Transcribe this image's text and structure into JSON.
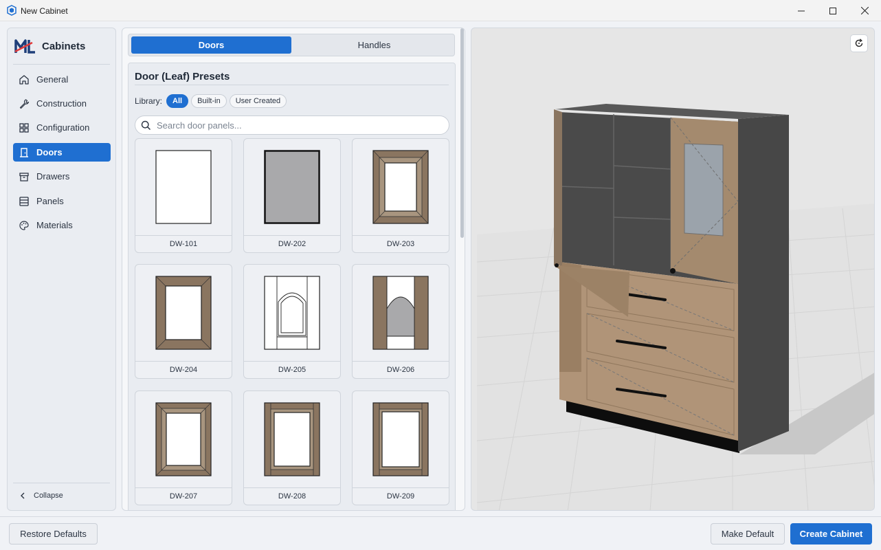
{
  "window": {
    "title": "New Cabinet"
  },
  "sidebar": {
    "brand": "Cabinets",
    "items": [
      {
        "label": "General",
        "icon": "home-icon",
        "active": false
      },
      {
        "label": "Construction",
        "icon": "wrench-icon",
        "active": false
      },
      {
        "label": "Configuration",
        "icon": "grid-icon",
        "active": false
      },
      {
        "label": "Doors",
        "icon": "door-icon",
        "active": true
      },
      {
        "label": "Drawers",
        "icon": "drawer-icon",
        "active": false
      },
      {
        "label": "Panels",
        "icon": "panels-icon",
        "active": false
      },
      {
        "label": "Materials",
        "icon": "palette-icon",
        "active": false
      }
    ],
    "collapse_label": "Collapse"
  },
  "tabs": [
    {
      "label": "Doors",
      "active": true
    },
    {
      "label": "Handles",
      "active": false
    }
  ],
  "presets": {
    "title": "Door (Leaf) Presets",
    "library_label": "Library:",
    "filters": [
      {
        "label": "All",
        "active": true
      },
      {
        "label": "Built-in",
        "active": false
      },
      {
        "label": "User Created",
        "active": false
      }
    ],
    "search_placeholder": "Search door panels...",
    "items": [
      {
        "code": "DW-101",
        "style": "flat-white"
      },
      {
        "code": "DW-202",
        "style": "flat-gray"
      },
      {
        "code": "DW-203",
        "style": "frame-wood-narrow"
      },
      {
        "code": "DW-204",
        "style": "frame-wood-wide"
      },
      {
        "code": "DW-205",
        "style": "arch-white"
      },
      {
        "code": "DW-206",
        "style": "arch-wood"
      },
      {
        "code": "DW-207",
        "style": "frame-wood-wide"
      },
      {
        "code": "DW-208",
        "style": "shaker-wood"
      },
      {
        "code": "DW-209",
        "style": "shaker-wood"
      }
    ]
  },
  "colors": {
    "accent": "#1f6fd1",
    "wood": "#8a7560",
    "cabinet_body": "#474747"
  },
  "footer": {
    "restore_label": "Restore Defaults",
    "make_default_label": "Make Default",
    "create_label": "Create Cabinet"
  }
}
